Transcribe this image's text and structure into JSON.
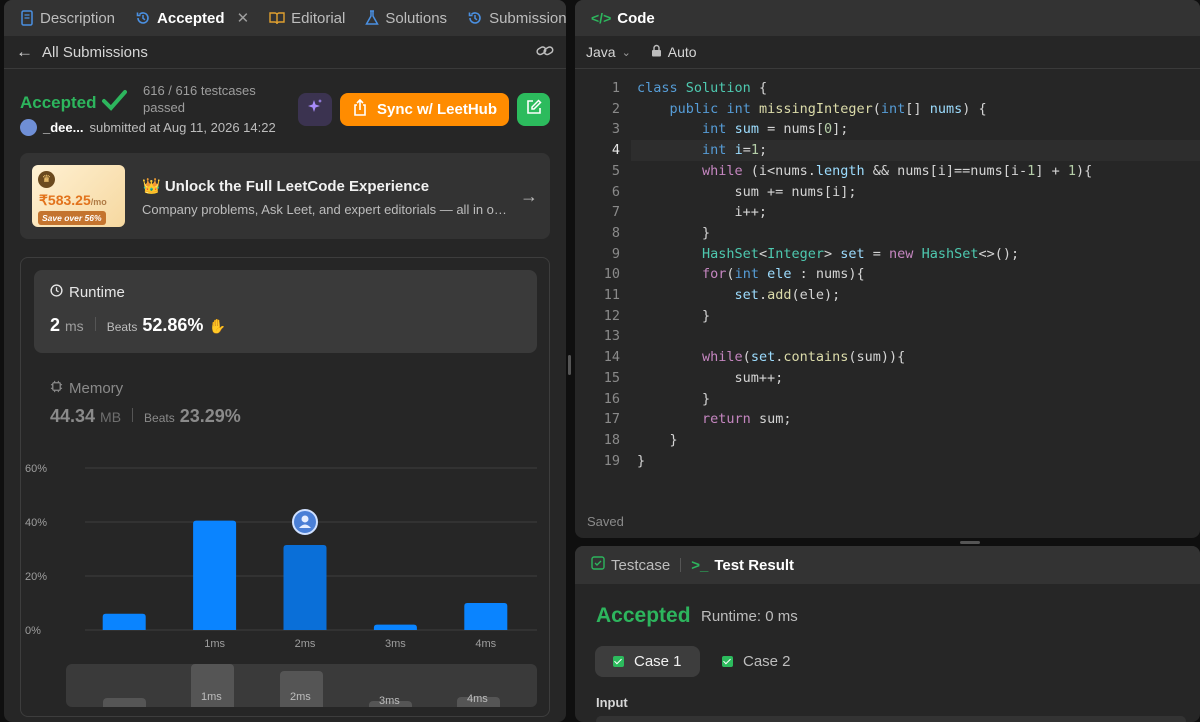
{
  "left_tabs": [
    {
      "label": "Description",
      "icon": "document-icon"
    },
    {
      "label": "Accepted",
      "icon": "history-icon"
    },
    {
      "label": "Editorial",
      "icon": "book-icon"
    },
    {
      "label": "Solutions",
      "icon": "flask-icon"
    },
    {
      "label": "Submissions",
      "icon": "history-icon"
    }
  ],
  "back_label": "All Submissions",
  "submission": {
    "status": "Accepted",
    "tests_line1": "616 / 616 testcases",
    "tests_line2": "passed",
    "user": "_dee...",
    "submitted": "submitted at Aug 11, 2026 14:22",
    "sync_label": "Sync w/ LeetHub"
  },
  "promo": {
    "price": "₹583.25",
    "per": "/mo",
    "save": "Save over 56%",
    "title": "👑 Unlock the Full LeetCode Experience",
    "subtitle": "Company problems, Ask Leet, and expert editorials — all in one place"
  },
  "runtime": {
    "label": "Runtime",
    "value": "2",
    "unit": "ms",
    "beats_label": "Beats",
    "beats": "52.86%"
  },
  "memory": {
    "label": "Memory",
    "value": "44.34",
    "unit": "MB",
    "beats_label": "Beats",
    "beats": "23.29%"
  },
  "chart_data": {
    "type": "bar",
    "categories": [
      "",
      "1ms",
      "2ms",
      "3ms",
      "4ms"
    ],
    "values": [
      6,
      40.5,
      31.5,
      2,
      10
    ],
    "ylim": [
      0,
      60
    ],
    "yticks": [
      "0%",
      "20%",
      "40%",
      "60%"
    ],
    "highlight_index": 2,
    "colors": {
      "bar": "#0a84ff",
      "highlight": "#0a6fd8",
      "grid": "#3d3d3d"
    }
  },
  "code_tab": {
    "label": "Code",
    "language": "Java",
    "mode": "Auto",
    "saved": "Saved"
  },
  "code_lines": [
    "class Solution {",
    "    public int missingInteger(int[] nums) {",
    "        int sum = nums[0];",
    "        int i=1;",
    "        while (i<nums.length && nums[i]==nums[i-1] + 1){",
    "            sum += nums[i];",
    "            i++;",
    "        }",
    "        HashSet<Integer> set = new HashSet<>();",
    "        for(int ele : nums){",
    "            set.add(ele);",
    "        }",
    "",
    "        while(set.contains(sum)){",
    "            sum++;",
    "        }",
    "        return sum;",
    "    }",
    "}"
  ],
  "result_tabs": [
    {
      "label": "Testcase"
    },
    {
      "label": "Test Result"
    }
  ],
  "result": {
    "status": "Accepted",
    "runtime": "Runtime: 0 ms",
    "cases": [
      "Case 1",
      "Case 2"
    ],
    "input_label": "Input"
  }
}
